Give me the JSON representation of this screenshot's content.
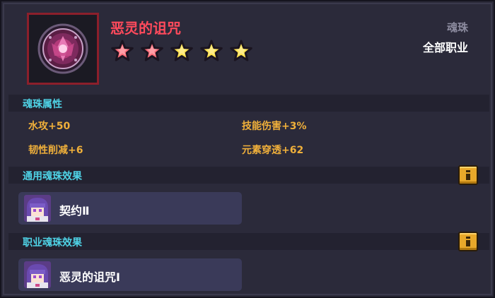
{
  "item": {
    "name": "恶灵的诅咒",
    "type": "魂珠",
    "class": "全部职业",
    "stars": {
      "filled": 5,
      "colors": [
        "#ff6a77",
        "#ff6a77",
        "#ffe24a",
        "#ffe24a",
        "#ffe24a"
      ]
    },
    "icon": "soul-orb-icon"
  },
  "attributes": {
    "title": "魂珠属性",
    "items": [
      "水攻+50",
      "技能伤害+3%",
      "韧性削减+6",
      "元素穿透+62"
    ]
  },
  "general_effects": {
    "title": "通用魂珠效果",
    "items": [
      {
        "label": "契约Ⅱ",
        "icon": "character-avatar-icon"
      }
    ]
  },
  "class_effects": {
    "title": "职业魂珠效果",
    "items": [
      {
        "label": "恶灵的诅咒Ⅰ",
        "icon": "character-avatar-icon"
      }
    ]
  },
  "colors": {
    "title": "#ff4a5c",
    "section": "#4fd3e6",
    "attribute": "#f0b03a",
    "panel": "#2b2a3a"
  }
}
